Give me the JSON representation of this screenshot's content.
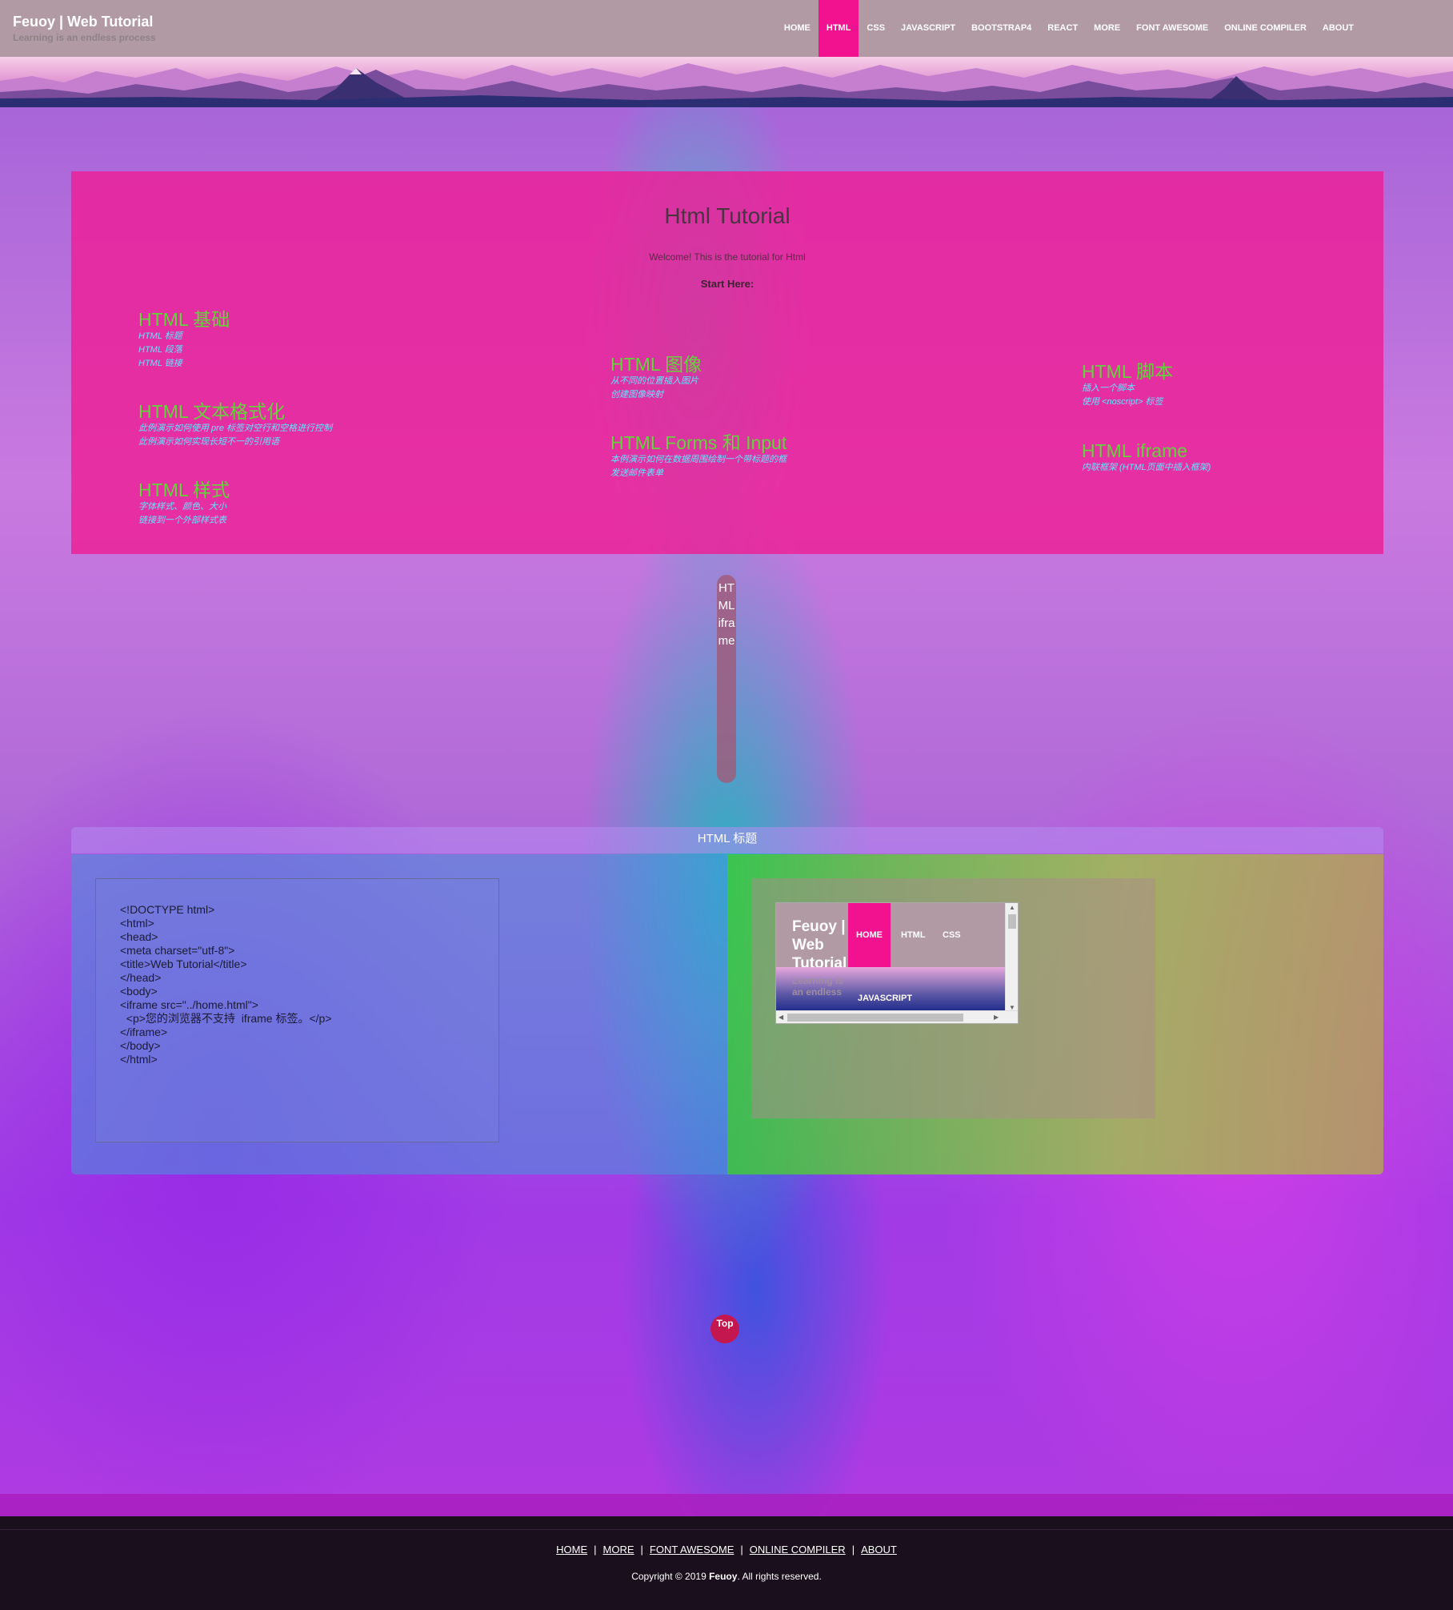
{
  "header": {
    "title": "Feuoy | Web Tutorial",
    "subtitle": "Learning is an endless process",
    "nav": [
      {
        "label": "HOME",
        "active": false
      },
      {
        "label": "HTML",
        "active": true
      },
      {
        "label": "CSS",
        "active": false
      },
      {
        "label": "JAVASCRIPT",
        "active": false
      },
      {
        "label": "BOOTSTRAP4",
        "active": false
      },
      {
        "label": "REACT",
        "active": false
      },
      {
        "label": "MORE",
        "active": false
      },
      {
        "label": "FONT AWESOME",
        "active": false
      },
      {
        "label": "ONLINE COMPILER",
        "active": false
      },
      {
        "label": "ABOUT",
        "active": false
      }
    ]
  },
  "tutorial": {
    "title": "Html Tutorial",
    "welcome": "Welcome! This is the tutorial for Html",
    "start": "Start Here:",
    "topics": [
      {
        "heading": "HTML 基础",
        "lines": [
          "HTML 标题",
          "HTML 段落",
          "HTML 链接"
        ]
      },
      {
        "heading": "HTML 文本格式化",
        "lines": [
          "此例演示如何使用 pre 标签对空行和空格进行控制",
          "此例演示如何实现长短不一的引用语"
        ]
      },
      {
        "heading": "HTML 样式",
        "lines": [
          "字体样式、颜色、大小",
          "链接到一个外部样式表"
        ]
      },
      {
        "heading": "HTML 图像",
        "lines": [
          "从不同的位置插入图片",
          "创建图像映射"
        ]
      },
      {
        "heading": "HTML Forms 和 Input",
        "lines": [
          "本例演示如何在数据周围绘制一个带标题的框",
          "发送邮件表单"
        ]
      },
      {
        "heading": "HTML 脚本",
        "lines": [
          "插入一个脚本",
          "使用 <noscript> 标签"
        ]
      },
      {
        "heading": "HTML iframe",
        "lines": [
          "内联框架 (HTML页面中插入框架)"
        ]
      }
    ]
  },
  "section_label": "HTML iframe",
  "example": {
    "title": "HTML 标题",
    "code": "<!DOCTYPE html>\n<html>\n<head>\n<meta charset=\"utf-8\">\n<title>Web Tutorial</title>\n</head>\n<body>\n<iframe src=\"../home.html\">\n  <p>您的浏览器不支持  iframe 标签。</p>\n</iframe>\n</body>\n</html>",
    "preview": {
      "title": "Feuoy | Web Tutorial",
      "subtitle": "Learning is an endless",
      "nav": [
        "HOME",
        "HTML",
        "CSS"
      ],
      "sub_nav": "JAVASCRIPT"
    }
  },
  "top_button": "Top",
  "footer": {
    "links": [
      "HOME",
      "MORE",
      "FONT AWESOME",
      "ONLINE COMPILER",
      "ABOUT"
    ],
    "copyright_prefix": "Copyright © 2019 ",
    "copyright_brand": "Feuoy",
    "copyright_suffix": ". All rights reserved."
  },
  "colors": {
    "nav_active": "#f2128f",
    "topic_heading": "#63d43a",
    "topic_link": "#63e4ff",
    "panel": "#ee1e96"
  }
}
